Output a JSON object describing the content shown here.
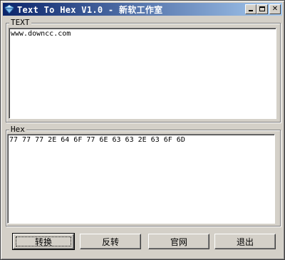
{
  "window": {
    "title": "Text To Hex V1.0 - 新软工作室",
    "icon": "app-icon"
  },
  "text_group": {
    "label": "TEXT",
    "value": "www.downcc.com"
  },
  "hex_group": {
    "label": "Hex",
    "value": "77 77 77 2E 64 6F 77 6E 63 63 2E 63 6F 6D"
  },
  "buttons": {
    "convert": "转换",
    "reverse": "反转",
    "website": "官网",
    "exit": "退出"
  },
  "colors": {
    "titlebar_start": "#0a246a",
    "titlebar_end": "#a6caf0",
    "face": "#d4d0c8"
  }
}
